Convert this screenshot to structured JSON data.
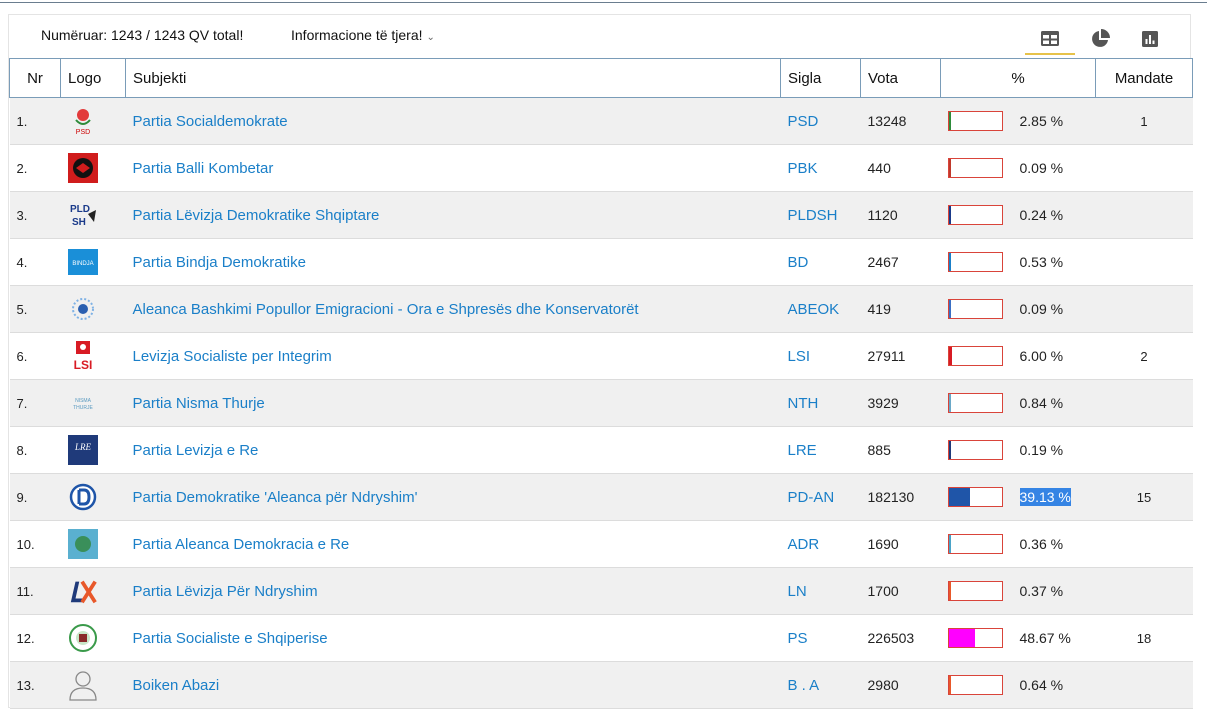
{
  "toolbar": {
    "count_text": "Numëruar: 1243 / 1243 QV total!",
    "info_label": "Informacione të tjera!",
    "views": [
      {
        "name": "table-view",
        "icon": "table-icon",
        "active": true
      },
      {
        "name": "pie-view",
        "icon": "pie-chart-icon",
        "active": false
      },
      {
        "name": "bar-view",
        "icon": "bar-chart-icon",
        "active": false
      }
    ]
  },
  "columns": {
    "nr": "Nr",
    "logo": "Logo",
    "subject": "Subjekti",
    "sigla": "Sigla",
    "votes": "Vota",
    "percent": "%",
    "seats": "Mandate"
  },
  "rows": [
    {
      "nr": "1.",
      "subject": "Partia Socialdemokrate",
      "sigla": "PSD",
      "votes": "13248",
      "percent_label": "2.85 %",
      "percent": 2.85,
      "bar_color": "#2e8b3a",
      "seats": "1",
      "logo_icon": "psd-rose-logo-icon"
    },
    {
      "nr": "2.",
      "subject": "Partia Balli Kombetar",
      "sigla": "PBK",
      "votes": "440",
      "percent_label": "0.09 %",
      "percent": 0.09,
      "bar_color": "#c0392b",
      "seats": "",
      "logo_icon": "eagle-emblem-logo-icon"
    },
    {
      "nr": "3.",
      "subject": "Partia Lëvizja Demokratike Shqiptare",
      "sigla": "PLDSH",
      "votes": "1120",
      "percent_label": "0.24 %",
      "percent": 0.24,
      "bar_color": "#1a3a8a",
      "seats": "",
      "logo_icon": "pldsh-logo-icon"
    },
    {
      "nr": "4.",
      "subject": "Partia Bindja Demokratike",
      "sigla": "BD",
      "votes": "2467",
      "percent_label": "0.53 %",
      "percent": 0.53,
      "bar_color": "#1a7fc8",
      "seats": "",
      "logo_icon": "bindja-logo-icon"
    },
    {
      "nr": "5.",
      "subject": "Aleanca Bashkimi Popullor Emigracioni - Ora e Shpresës dhe Konservatorët",
      "sigla": "ABEOK",
      "votes": "419",
      "percent_label": "0.09 %",
      "percent": 0.09,
      "bar_color": "#3a6fc4",
      "seats": "",
      "logo_icon": "star-circle-logo-icon"
    },
    {
      "nr": "6.",
      "subject": "Levizja Socialiste per Integrim",
      "sigla": "LSI",
      "votes": "27911",
      "percent_label": "6.00 %",
      "percent": 6.0,
      "bar_color": "#d81b24",
      "seats": "2",
      "logo_icon": "lsi-logo-icon"
    },
    {
      "nr": "7.",
      "subject": "Partia Nisma Thurje",
      "sigla": "NTH",
      "votes": "3929",
      "percent_label": "0.84 %",
      "percent": 0.84,
      "bar_color": "#6aa8c8",
      "seats": "",
      "logo_icon": "nisma-thurje-logo-icon"
    },
    {
      "nr": "8.",
      "subject": "Partia Levizja e Re",
      "sigla": "LRE",
      "votes": "885",
      "percent_label": "0.19 %",
      "percent": 0.19,
      "bar_color": "#1f3a7a",
      "seats": "",
      "logo_icon": "lre-logo-icon"
    },
    {
      "nr": "9.",
      "subject": "Partia Demokratike 'Aleanca për Ndryshim'",
      "sigla": "PD-AN",
      "votes": "182130",
      "percent_label": "39.13 %",
      "percent": 39.13,
      "bar_color": "#1f55a8",
      "seats": "15",
      "logo_icon": "pd-logo-icon",
      "selected": true
    },
    {
      "nr": "10.",
      "subject": "Partia Aleanca Demokracia e Re",
      "sigla": "ADR",
      "votes": "1690",
      "percent_label": "0.36 %",
      "percent": 0.36,
      "bar_color": "#4aa3c8",
      "seats": "",
      "logo_icon": "adr-logo-icon"
    },
    {
      "nr": "11.",
      "subject": "Partia Lëvizja Për Ndryshim",
      "sigla": "LN",
      "votes": "1700",
      "percent_label": "0.37 %",
      "percent": 0.37,
      "bar_color": "#e8582a",
      "seats": "",
      "logo_icon": "ln-logo-icon"
    },
    {
      "nr": "12.",
      "subject": "Partia Socialiste e Shqiperise",
      "sigla": "PS",
      "votes": "226503",
      "percent_label": "48.67 %",
      "percent": 48.67,
      "bar_color": "#ff00ff",
      "seats": "18",
      "logo_icon": "ps-logo-icon"
    },
    {
      "nr": "13.",
      "subject": "Boiken Abazi",
      "sigla": "B . A",
      "votes": "2980",
      "percent_label": "0.64 %",
      "percent": 0.64,
      "bar_color": "#e8582a",
      "seats": "",
      "logo_icon": "person-avatar-icon"
    }
  ]
}
